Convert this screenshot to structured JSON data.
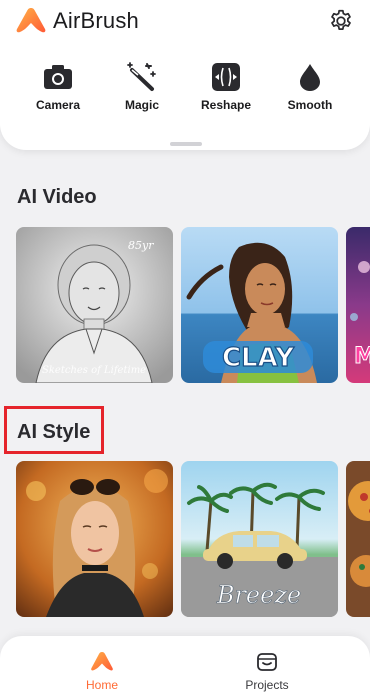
{
  "app": {
    "title": "AirBrush",
    "brand_color": "#ff7a2f"
  },
  "tools": [
    {
      "label": "Camera",
      "icon": "camera-icon"
    },
    {
      "label": "Magic",
      "icon": "magic-wand-icon"
    },
    {
      "label": "Reshape",
      "icon": "reshape-icon"
    },
    {
      "label": "Smooth",
      "icon": "smooth-drop-icon"
    }
  ],
  "sections": {
    "ai_video": {
      "title": "AI Video",
      "cards": [
        {
          "caption": "Sketches of Lifetime",
          "badge": "85yr"
        },
        {
          "caption": "CLAY"
        },
        {
          "caption": "M"
        }
      ]
    },
    "ai_style": {
      "title": "AI Style",
      "cards": [
        {
          "caption": ""
        },
        {
          "caption": "Breeze"
        },
        {
          "caption": ""
        }
      ]
    }
  },
  "nav": {
    "home_label": "Home",
    "projects_label": "Projects",
    "active": "Home",
    "active_color": "#ff6b35"
  },
  "highlight_color": "#e5242b"
}
